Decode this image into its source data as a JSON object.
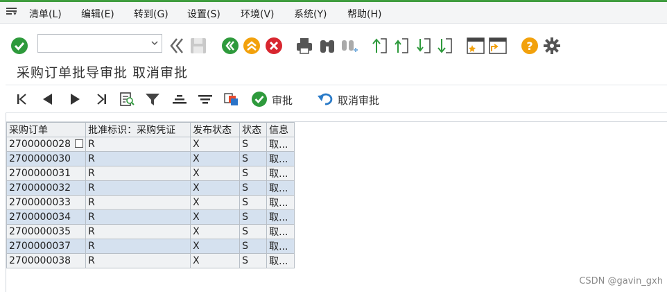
{
  "menu": {
    "items": [
      "清单(L)",
      "编辑(E)",
      "转到(G)",
      "设置(S)",
      "环境(V)",
      "系统(Y)",
      "帮助(H)"
    ]
  },
  "toolbar": {
    "command_value": "",
    "icons": [
      "enter-icon",
      "back-double-icon",
      "save-icon",
      "back-icon",
      "exit-icon",
      "cancel-icon",
      "print-icon",
      "find-icon",
      "find-next-icon",
      "first-page-icon",
      "previous-page-icon",
      "next-page-icon",
      "last-page-icon",
      "create-session-icon",
      "shortcut-icon",
      "help-icon",
      "settings-icon"
    ]
  },
  "page": {
    "title": "采购订单批导审批 取消审批"
  },
  "app_toolbar": {
    "approve_label": "审批",
    "cancel_approve_label": "取消审批"
  },
  "grid": {
    "headers": [
      "采购订单",
      "批准标识：采购凭证",
      "发布状态",
      "状态",
      "信息"
    ],
    "rows": [
      [
        "2700000028",
        "R",
        "X",
        "S",
        "取..."
      ],
      [
        "2700000030",
        "R",
        "X",
        "S",
        "取..."
      ],
      [
        "2700000031",
        "R",
        "X",
        "S",
        "取..."
      ],
      [
        "2700000032",
        "R",
        "X",
        "S",
        "取..."
      ],
      [
        "2700000033",
        "R",
        "X",
        "S",
        "取..."
      ],
      [
        "2700000034",
        "R",
        "X",
        "S",
        "取..."
      ],
      [
        "2700000035",
        "R",
        "X",
        "S",
        "取..."
      ],
      [
        "2700000037",
        "R",
        "X",
        "S",
        "取..."
      ],
      [
        "2700000038",
        "R",
        "X",
        "S",
        "取..."
      ]
    ]
  },
  "watermark": "CSDN @gavin_gxh",
  "colors": {
    "accent_green": "#2e9a3c",
    "header_bg": "#eef0f2",
    "row_even": "#d5e1ef",
    "row_odd": "#f0f2f4"
  }
}
